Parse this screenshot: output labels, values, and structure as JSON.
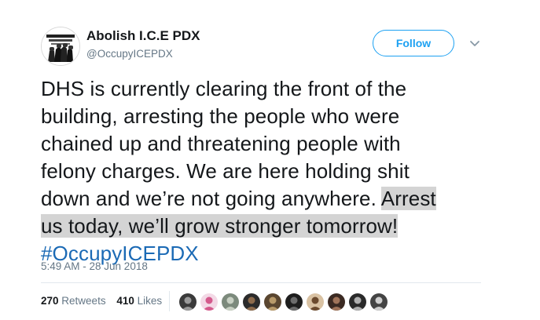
{
  "author": {
    "display_name": "Abolish I.C.E PDX",
    "handle": "@OccupyICEPDX",
    "avatar_icon": "protest-fists-logo-icon"
  },
  "actions": {
    "follow_label": "Follow",
    "menu_icon": "chevron-down-icon"
  },
  "tweet": {
    "line1": "DHS is currently clearing the front of the",
    "line2": "building, arresting the people who were",
    "line3": "chained up and threatening people with",
    "line4": "felony charges. We are here holding shit",
    "line5_plain": "down and we’re not going anywhere. ",
    "line5_highlight": "Arrest",
    "line6_highlight": "us today, we’ll grow stronger tomorrow!",
    "hashtag": "#OccupyICEPDX",
    "timestamp": "5:49 AM - 28 Jun 2018"
  },
  "stats": {
    "retweets_count": "270",
    "retweets_label": "Retweets",
    "likes_count": "410",
    "likes_label": "Likes"
  },
  "likers": [
    {
      "name": "liker-avatar-1",
      "color": "#3a3a3a",
      "accent": "#9a9a9a"
    },
    {
      "name": "liker-avatar-2",
      "color": "#f3d9e6",
      "accent": "#d45a8c"
    },
    {
      "name": "liker-avatar-3",
      "color": "#7c8a7c",
      "accent": "#c9d1c4"
    },
    {
      "name": "liker-avatar-4",
      "color": "#2b2b2b",
      "accent": "#8d6b4c"
    },
    {
      "name": "liker-avatar-5",
      "color": "#5a4630",
      "accent": "#b89a6a"
    },
    {
      "name": "liker-avatar-6",
      "color": "#1e1e1e",
      "accent": "#6c6c6c"
    },
    {
      "name": "liker-avatar-7",
      "color": "#d9c2a3",
      "accent": "#6b4a2e"
    },
    {
      "name": "liker-avatar-8",
      "color": "#3b2a22",
      "accent": "#a0745a"
    },
    {
      "name": "liker-avatar-9",
      "color": "#2a2a2a",
      "accent": "#b0b0b0"
    },
    {
      "name": "liker-avatar-10",
      "color": "#444444",
      "accent": "#cfcfcf"
    }
  ],
  "colors": {
    "link_blue": "#1da1f2",
    "hashtag_blue": "#1b6ab5",
    "muted_gray": "#657786",
    "highlight_gray": "#d4d4d4"
  }
}
